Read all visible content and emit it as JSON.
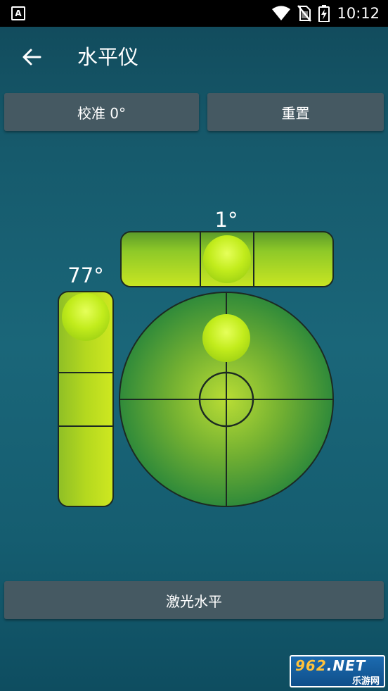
{
  "status_bar": {
    "app_icon_letter": "A",
    "time": "10:12",
    "icons": [
      "wifi-icon",
      "no-sim-icon",
      "battery-charging-icon"
    ]
  },
  "app_bar": {
    "back_icon": "arrow-left-icon",
    "title": "水平仪"
  },
  "toolbar": {
    "calibrate_label": "校准 0°",
    "reset_label": "重置"
  },
  "levels": {
    "horizontal_readout": "1°",
    "vertical_readout": "77°",
    "horizontal_bubble_fraction": 0.5,
    "vertical_bubble_fraction": 0.0,
    "circular_bubble_offset": [
      0.0,
      -0.75
    ]
  },
  "laser_button_label": "激光水平",
  "watermark": {
    "top_number": "962",
    "top_suffix": ".NET",
    "bottom_text": "乐游网"
  },
  "colors": {
    "background": "#165a6c",
    "button": "#455962",
    "bubble": "#c6f020",
    "vial": "#8ec928"
  }
}
